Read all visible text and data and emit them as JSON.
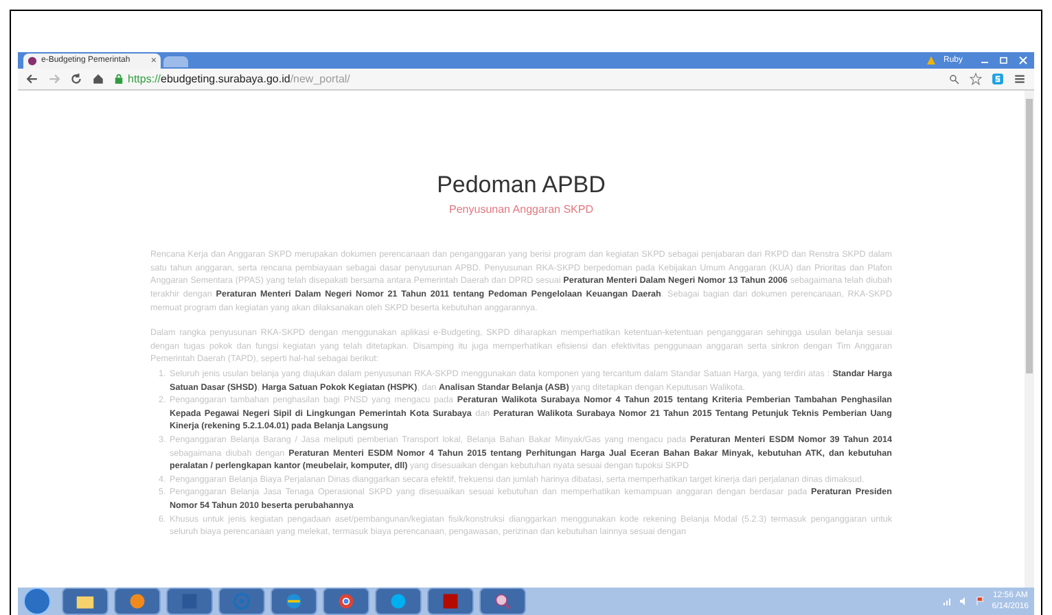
{
  "browser": {
    "tab_title": "e-Budgeting Pemerintah",
    "tab_close": "×",
    "profile": "Ruby",
    "address": {
      "scheme": "https://",
      "host": "ebudgeting.surabaya.go.id",
      "path": "/new_portal/"
    }
  },
  "page": {
    "title": "Pedoman APBD",
    "subtitle": "Penyusunan Anggaran SKPD",
    "paragraphs": [
      "Rencana Kerja dan Anggaran SKPD merupakan dokumen perencanaan dan penganggaran yang berisi program dan kegiatan SKPD sebagai penjabaran dari RKPD dan Renstra SKPD dalam satu tahun anggaran, serta rencana pembiayaan sebagai dasar penyusunan APBD. Penyusunan RKA-SKPD berpedoman pada Kebijakan Umum Anggaran (KUA) dan Prioritas dan Plafon Anggaran Sementara (PPAS) yang telah disepakati bersama antara Pemerintah Daerah dan DPRD sesuai **Peraturan Menteri Dalam Negeri Nomor 13 Tahun 2006** sebagaimana telah diubah terakhir dengan **Peraturan Menteri Dalam Negeri Nomor 21 Tahun 2011 tentang Pedoman Pengelolaan Keuangan Daerah**. Sebagai bagian dari dokumen perencanaan, RKA-SKPD memuat program dan kegiatan yang akan dilaksanakan oleh SKPD beserta kebutuhan anggarannya.",
      "Dalam rangka penyusunan RKA-SKPD dengan menggunakan aplikasi e-Budgeting, SKPD diharapkan memperhatikan ketentuan-ketentuan penganggaran sehingga usulan belanja sesuai dengan tugas pokok dan fungsi kegiatan yang telah ditetapkan. Disamping itu juga memperhatikan efisiensi dan efektivitas penggunaan anggaran serta sinkron dengan Tim Anggaran Pemerintah Daerah (TAPD), seperti hal-hal sebagai berikut:"
    ],
    "list": [
      {
        "number": "1.",
        "text": "Seluruh jenis usulan belanja yang diajukan dalam penyusunan RKA-SKPD menggunakan data komponen yang tercantum dalam Standar Satuan Harga, yang terdiri atas : **Standar Harga Satuan Dasar (SHSD)**, **Harga Satuan Pokok Kegiatan (HSPK)**, dan **Analisan Standar Belanja (ASB)** yang ditetapkan dengan Keputusan Walikota."
      },
      {
        "number": "2.",
        "text": "Penganggaran tambahan penghasilan bagi PNSD yang mengacu pada **Peraturan Walikota Surabaya Nomor 4 Tahun 2015 tentang Kriteria Pemberian Tambahan Penghasilan Kepada Pegawai Negeri Sipil di Lingkungan Pemerintah Kota Surabaya** dan **Peraturan Walikota Surabaya Nomor 21 Tahun 2015 Tentang Petunjuk Teknis Pemberian Uang Kinerja (rekening 5.2.1.04.01) pada Belanja Langsung**"
      },
      {
        "number": "3.",
        "text": "Penganggaran Belanja Barang / Jasa meliputi pemberian Transport lokal, Belanja Bahan Bakar Minyak/Gas yang mengacu pada **Peraturan Menteri ESDM Nomor 39 Tahun 2014** sebagaimana diubah dengan **Peraturan Menteri ESDM Nomor 4 Tahun 2015 tentang Perhitungan Harga Jual Eceran Bahan Bakar Minyak, kebutuhan ATK, dan kebutuhan peralatan / perlengkapan kantor (meubelair, komputer, dll)** yang disesuaikan dengan kebutuhan nyata sesuai dengan tupoksi SKPD"
      },
      {
        "number": "4.",
        "text": "Penganggaran Belanja Biaya Perjalanan Dinas dianggarkan secara efektif, frekuensi dan jumlah harinya dibatasi, serta memperhatikan target kinerja dari perjalanan dinas dimaksud."
      },
      {
        "number": "5.",
        "text": "Penganggaran Belanja Jasa Tenaga Operasional SKPD yang disesuaikan sesuai kebutuhan dan memperhatikan kemampuan anggaran dengan berdasar pada **Peraturan Presiden Nomor 54 Tahun 2010 beserta perubahannya**"
      },
      {
        "number": "6.",
        "text": "Khusus untuk jenis kegiatan pengadaan aset/pembangunan/kegiatan fisik/konstruksi dianggarkan menggunakan kode rekening Belanja Modal (5.2.3) termasuk penganggaran untuk seluruh biaya perencanaan yang melekat, termasuk biaya perencanaan, pengawasan, perizinan dan kebutuhan lainnya sesuai dengan"
      }
    ]
  },
  "taskbar": {
    "time": "12:56 AM",
    "date": "6/14/2016"
  }
}
